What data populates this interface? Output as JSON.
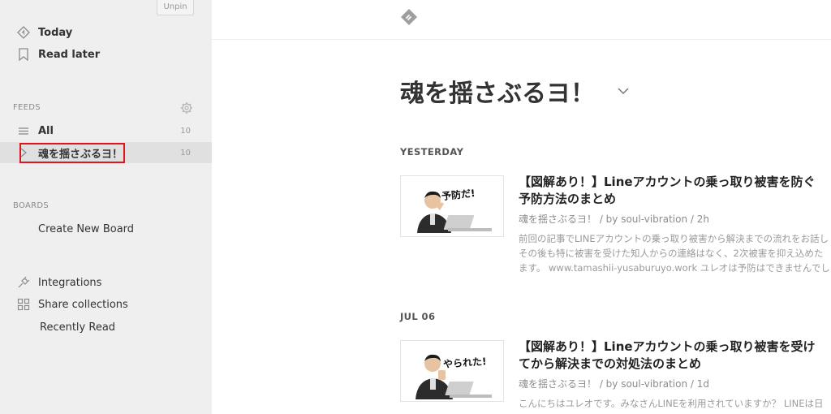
{
  "sidebar": {
    "unpin_label": "Unpin",
    "today_label": "Today",
    "read_later_label": "Read later",
    "feeds_title": "FEEDS",
    "all_label": "All",
    "all_count": "10",
    "feed_label": "魂を揺さぶるヨ！",
    "feed_count": "10",
    "boards_title": "BOARDS",
    "create_board_label": "Create New Board",
    "integrations_label": "Integrations",
    "share_collections_label": "Share collections",
    "recently_read_label": "Recently Read"
  },
  "main": {
    "feed_title": "魂を揺さぶるヨ！",
    "sections": [
      {
        "day": "YESTERDAY",
        "entry": {
          "thumb_caption": "予防だ!",
          "title": "【図解あり！】Lineアカウントの乗っ取り被害を防ぐ予防方法のまとめ",
          "meta": "魂を揺さぶるヨ！ / by soul-vibration / 2h",
          "summary": [
            "前回の記事でLINEアカウントの乗っ取り被害から解決までの流れをお話し",
            "その後も特に被害を受けた知人からの連絡はなく、2次被害を抑え込めた",
            "ます。 www.tamashii-yusaburuyo.work ユレオは予防はできませんでし"
          ]
        }
      },
      {
        "day": "JUL 06",
        "entry": {
          "thumb_caption": "やられた!",
          "title": "【図解あり！】Lineアカウントの乗っ取り被害を受けてから解決までの対処法のまとめ",
          "meta": "魂を揺さぶるヨ！ / by soul-vibration / 1d",
          "summary": [
            "こんにちはユレオです。みなさんLINEを利用されていますか？ LINEは日"
          ]
        }
      }
    ]
  },
  "colors": {
    "sidebar_bg": "#efefef",
    "selected_bg": "#e0e0e0",
    "highlight": "#e0141e"
  }
}
